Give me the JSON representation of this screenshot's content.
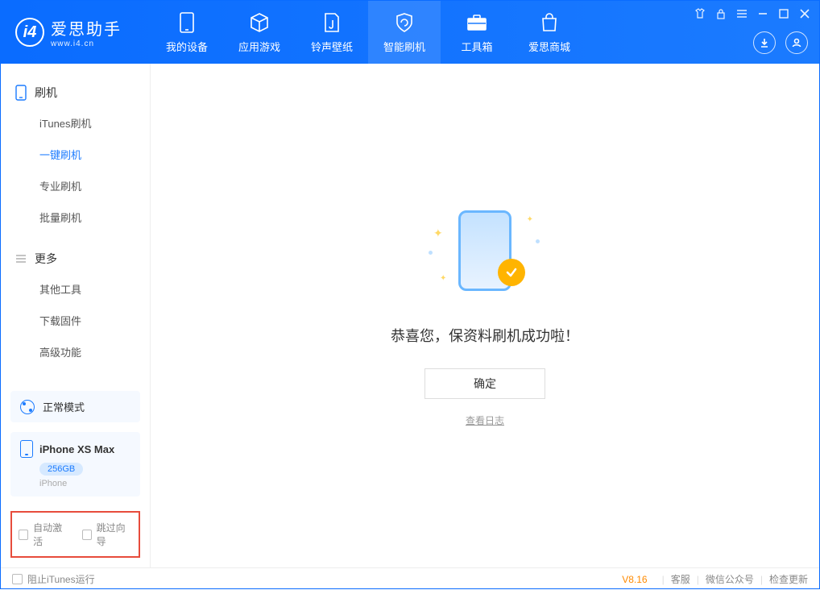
{
  "header": {
    "logo_title": "爱思助手",
    "logo_sub": "www.i4.cn",
    "tabs": [
      {
        "label": "我的设备"
      },
      {
        "label": "应用游戏"
      },
      {
        "label": "铃声壁纸"
      },
      {
        "label": "智能刷机"
      },
      {
        "label": "工具箱"
      },
      {
        "label": "爱思商城"
      }
    ]
  },
  "sidebar": {
    "section_flash": "刷机",
    "items_flash": [
      {
        "label": "iTunes刷机"
      },
      {
        "label": "一键刷机"
      },
      {
        "label": "专业刷机"
      },
      {
        "label": "批量刷机"
      }
    ],
    "section_more": "更多",
    "items_more": [
      {
        "label": "其他工具"
      },
      {
        "label": "下载固件"
      },
      {
        "label": "高级功能"
      }
    ],
    "mode_label": "正常模式",
    "device": {
      "name": "iPhone XS Max",
      "storage": "256GB",
      "type": "iPhone"
    },
    "chk_auto_activate": "自动激活",
    "chk_skip_guide": "跳过向导"
  },
  "main": {
    "success_text": "恭喜您，保资料刷机成功啦！",
    "ok_button": "确定",
    "view_log": "查看日志"
  },
  "footer": {
    "block_itunes": "阻止iTunes运行",
    "version": "V8.16",
    "links": [
      {
        "label": "客服"
      },
      {
        "label": "微信公众号"
      },
      {
        "label": "检查更新"
      }
    ]
  }
}
